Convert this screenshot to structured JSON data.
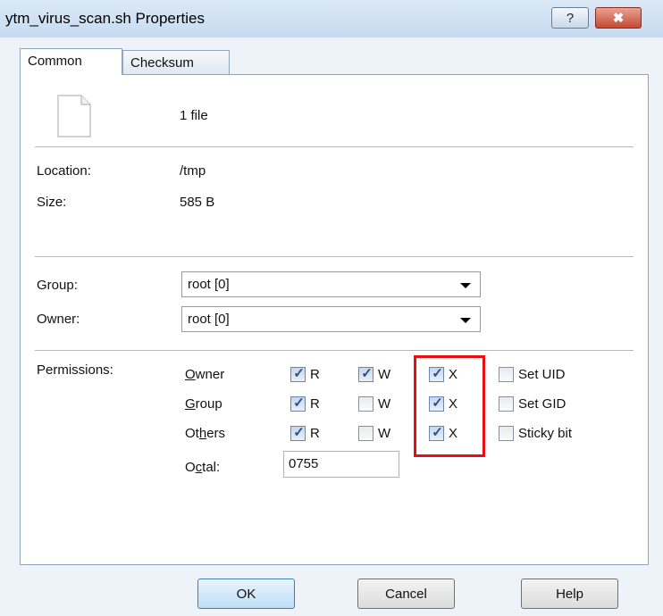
{
  "window": {
    "title": "ytm_virus_scan.sh Properties",
    "help_glyph": "?",
    "close_glyph": "✖"
  },
  "tabs": [
    {
      "label": "Common",
      "active": true
    },
    {
      "label": "Checksum",
      "active": false
    }
  ],
  "file": {
    "count_text": "1 file",
    "location_label": "Location:",
    "location_value": "/tmp",
    "size_label": "Size:",
    "size_value": "585 B"
  },
  "group": {
    "label": "Group:",
    "value": "root [0]"
  },
  "owner": {
    "label": "Owner:",
    "value": "root [0]"
  },
  "permissions": {
    "label": "Permissions:",
    "rows": [
      {
        "who": "Owner",
        "who_key": "O",
        "who_rest": "wner",
        "r": true,
        "w": true,
        "x": true,
        "special": "Set UID",
        "special_checked": false
      },
      {
        "who": "Group",
        "who_key": "G",
        "who_rest": "roup",
        "r": true,
        "w": false,
        "x": true,
        "special": "Set GID",
        "special_checked": false
      },
      {
        "who": "Others",
        "who_pre": "Ot",
        "who_key": "h",
        "who_rest": "ers",
        "r": true,
        "w": false,
        "x": true,
        "special": "Sticky bit",
        "special_checked": false
      }
    ],
    "r_label": "R",
    "w_label": "W",
    "x_label": "X",
    "octal_pre": "O",
    "octal_key": "c",
    "octal_rest": "tal:",
    "octal_value": "0755"
  },
  "buttons": {
    "ok": "OK",
    "cancel": "Cancel",
    "help": "Help"
  },
  "colors": {
    "highlight_box": "#e50f14",
    "checkmark": "#2f4e85"
  }
}
